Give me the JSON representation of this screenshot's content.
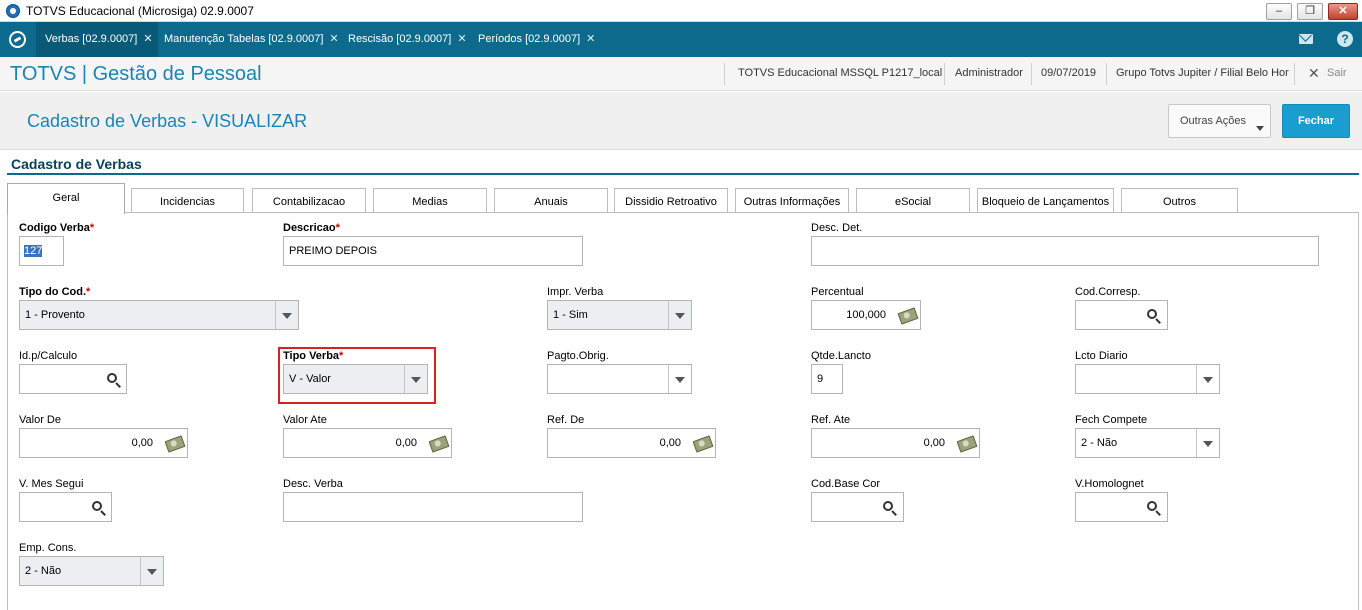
{
  "window": {
    "title": "TOTVS Educacional (Microsiga) 02.9.0007",
    "min": "–",
    "restore": "❐",
    "close": "✕"
  },
  "tabs": [
    {
      "label": "Verbas [02.9.0007]",
      "close": "✕"
    },
    {
      "label": "Manutenção Tabelas [02.9.0007]",
      "close": "✕"
    },
    {
      "label": "Rescisão [02.9.0007]",
      "close": "✕"
    },
    {
      "label": "Períodos [02.9.0007]",
      "close": "✕"
    }
  ],
  "header": {
    "product": "TOTVS | Gestão de Pessoal",
    "environment": "TOTVS Educacional MSSQL P1217_local",
    "user": "Administrador",
    "date": "09/07/2019",
    "company": "Grupo Totvs Jupiter / Filial Belo Hor",
    "exit": "Sair",
    "help": "?"
  },
  "page": {
    "title": "Cadastro de Verbas - VISUALIZAR",
    "other_actions": "Outras Ações",
    "close": "Fechar"
  },
  "section": "Cadastro de Verbas",
  "folders": [
    "Geral",
    "Incidencias",
    "Contabilizacao",
    "Medias",
    "Anuais",
    "Dissidio Retroativo",
    "Outras Informações",
    "eSocial",
    "Bloqueio de Lançamentos",
    "Outros"
  ],
  "form": {
    "codigo_verba": {
      "label": "Codigo Verba",
      "value": "127"
    },
    "descricao": {
      "label": "Descricao",
      "value": "PREIMO DEPOIS"
    },
    "desc_det": {
      "label": "Desc. Det.",
      "value": ""
    },
    "tipo_cod": {
      "label": "Tipo do Cod.",
      "value": "1 - Provento"
    },
    "impr_verba": {
      "label": "Impr. Verba",
      "value": "1 - Sim"
    },
    "percentual": {
      "label": "Percentual",
      "value": "100,000"
    },
    "cod_corresp": {
      "label": "Cod.Corresp.",
      "value": ""
    },
    "id_calculo": {
      "label": "Id.p/Calculo",
      "value": ""
    },
    "tipo_verba": {
      "label": "Tipo Verba",
      "value": "V - Valor"
    },
    "pagto_obrig": {
      "label": "Pagto.Obrig.",
      "value": ""
    },
    "qtde_lancto": {
      "label": "Qtde.Lancto",
      "value": "9"
    },
    "lcto_diario": {
      "label": "Lcto Diario",
      "value": ""
    },
    "valor_de": {
      "label": "Valor De",
      "value": "0,00"
    },
    "valor_ate": {
      "label": "Valor Ate",
      "value": "0,00"
    },
    "ref_de": {
      "label": "Ref. De",
      "value": "0,00"
    },
    "ref_ate": {
      "label": "Ref. Ate",
      "value": "0,00"
    },
    "fech_compete": {
      "label": "Fech Compete",
      "value": "2 - Não"
    },
    "v_mes_segui": {
      "label": "V. Mes Segui",
      "value": ""
    },
    "desc_verba": {
      "label": "Desc. Verba",
      "value": ""
    },
    "cod_base_cor": {
      "label": "Cod.Base Cor",
      "value": ""
    },
    "v_homolognet": {
      "label": "V.Homolognet",
      "value": ""
    },
    "emp_cons": {
      "label": "Emp. Cons.",
      "value": "2 - Não"
    },
    "required_mark": "*"
  }
}
